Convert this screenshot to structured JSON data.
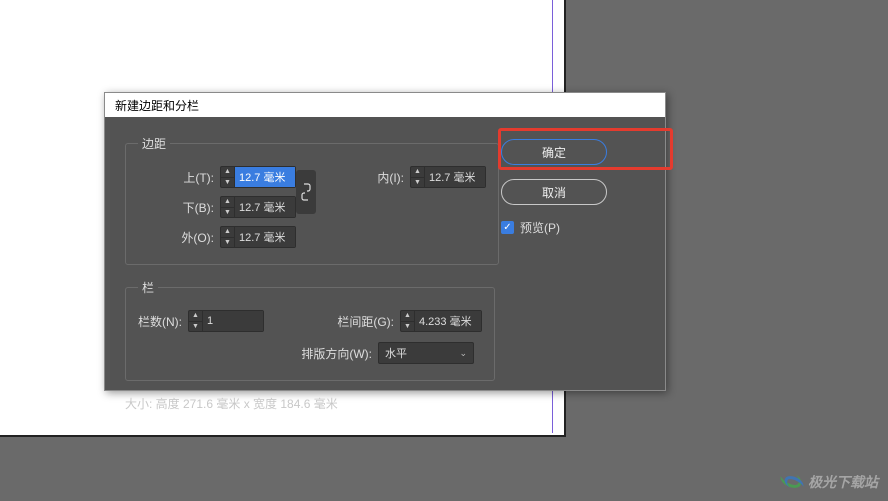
{
  "dialog": {
    "title": "新建边距和分栏",
    "margins": {
      "legend": "边距",
      "top_label": "上(T)",
      "bottom_label": "下(B)",
      "inner_label": "内(I)",
      "outer_label": "外(O)",
      "top_value": "12.7 毫米",
      "bottom_value": "12.7 毫米",
      "inner_value": "12.7 毫米",
      "outer_value": "12.7 毫米",
      "link_icon": "link-icon"
    },
    "columns": {
      "legend": "栏",
      "count_label": "栏数(N)",
      "count_value": "1",
      "gutter_label": "栏间距(G)",
      "gutter_value": "4.233 毫米",
      "direction_label": "排版方向(W)",
      "direction_value": "水平"
    },
    "size_text": "大小: 高度 271.6 毫米 x 宽度 184.6 毫米",
    "buttons": {
      "ok": "确定",
      "cancel": "取消"
    },
    "preview": {
      "label": "预览(P)",
      "checked": true
    }
  },
  "watermark": {
    "text": "极光下载站"
  }
}
